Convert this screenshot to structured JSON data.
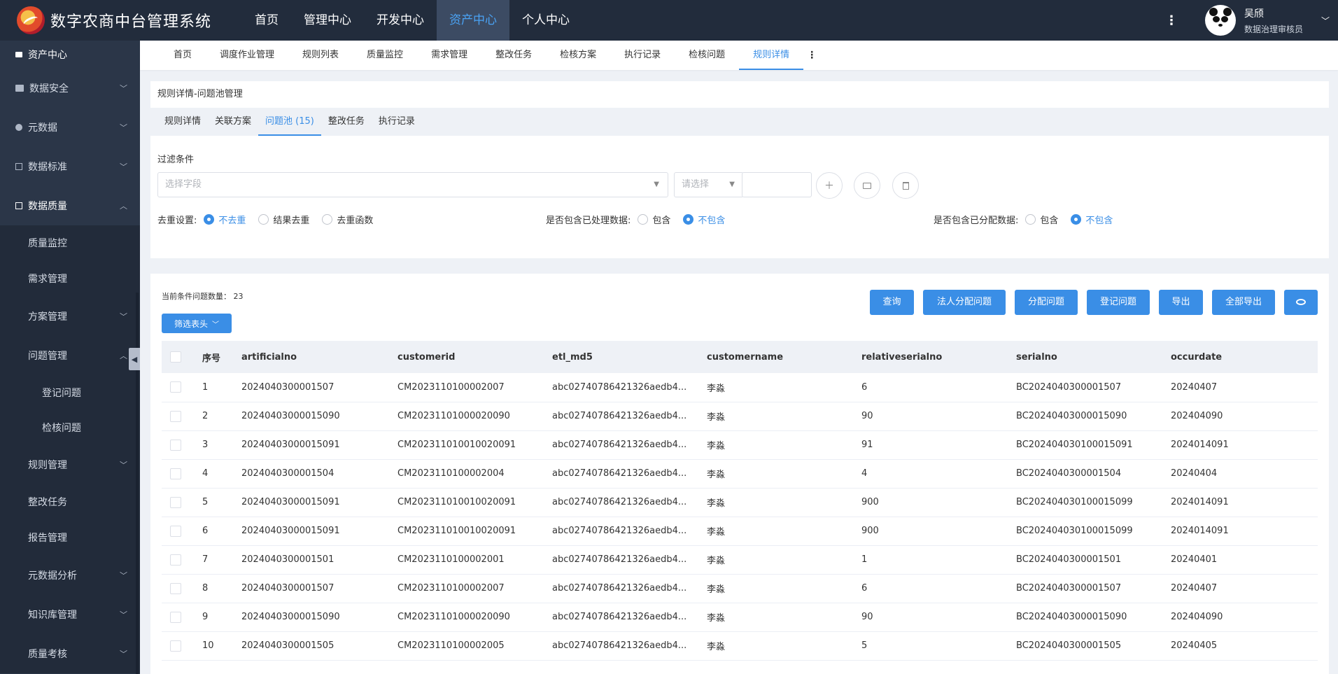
{
  "app": {
    "title": "数字农商中台管理系统"
  },
  "topnav": [
    "首页",
    "管理中心",
    "开发中心",
    "资产中心",
    "个人中心"
  ],
  "topnav_active": 3,
  "user": {
    "name": "吴颀",
    "role": "数据治理审核员"
  },
  "sidebar": {
    "head": "资产中心",
    "items": [
      {
        "label": "数据安全",
        "icon": "folder-icon"
      },
      {
        "label": "元数据",
        "icon": "pie-icon"
      },
      {
        "label": "数据标准",
        "icon": "edit-icon"
      },
      {
        "label": "数据质量",
        "icon": "calendar-icon"
      }
    ],
    "quality_children": [
      {
        "label": "质量监控"
      },
      {
        "label": "需求管理"
      },
      {
        "label": "方案管理"
      },
      {
        "label": "问题管理"
      },
      {
        "label": "登记问题"
      },
      {
        "label": "检核问题"
      },
      {
        "label": "规则管理"
      },
      {
        "label": "整改任务"
      },
      {
        "label": "报告管理"
      },
      {
        "label": "元数据分析"
      },
      {
        "label": "知识库管理"
      },
      {
        "label": "质量考核"
      }
    ]
  },
  "tabs": [
    "首页",
    "调度作业管理",
    "规则列表",
    "质量监控",
    "需求管理",
    "整改任务",
    "检核方案",
    "执行记录",
    "检核问题",
    "规则详情"
  ],
  "tabs_active": 9,
  "panel": {
    "title": "规则详情-问题池管理",
    "subtabs": [
      "规则详情",
      "关联方案",
      "问题池 (15)",
      "整改任务",
      "执行记录"
    ],
    "subtabs_active": 2,
    "filter_label": "过滤条件",
    "field_placeholder": "选择字段",
    "op_placeholder": "请选择",
    "dedup_label": "去重设置:",
    "dedup_options": [
      "不去重",
      "结果去重",
      "去重函数"
    ],
    "processed_label": "是否包含已处理数据:",
    "processed_options": [
      "包含",
      "不包含"
    ],
    "assigned_label": "是否包含已分配数据:",
    "assigned_options": [
      "包含",
      "不包含"
    ]
  },
  "results": {
    "count_text": "当前条件问题数量： 23",
    "filter_head_button": "筛选表头",
    "buttons": [
      "查询",
      "法人分配问题",
      "分配问题",
      "登记问题",
      "导出",
      "全部导出"
    ],
    "columns": [
      "序号",
      "artificialno",
      "customerid",
      "etl_md5",
      "customername",
      "relativeserialno",
      "serialno",
      "occurdate"
    ],
    "rows": [
      [
        "1",
        "2024040300001507",
        "CM2023110100002007",
        "abc02740786421326aedb4...",
        "李淼",
        "6",
        "BC2024040300001507",
        "20240407"
      ],
      [
        "2",
        "20240403000015090",
        "CM20231101000020090",
        "abc02740786421326aedb4...",
        "李淼",
        "90",
        "BC20240403000015090",
        "202404090"
      ],
      [
        "3",
        "20240403000015091",
        "CM202311010010020091",
        "abc02740786421326aedb4...",
        "李淼",
        "91",
        "BC202404030100015091",
        "2024014091"
      ],
      [
        "4",
        "2024040300001504",
        "CM2023110100002004",
        "abc02740786421326aedb4...",
        "李淼",
        "4",
        "BC2024040300001504",
        "20240404"
      ],
      [
        "5",
        "20240403000015091",
        "CM202311010010020091",
        "abc02740786421326aedb4...",
        "李淼",
        "900",
        "BC202404030100015099",
        "2024014091"
      ],
      [
        "6",
        "20240403000015091",
        "CM202311010010020091",
        "abc02740786421326aedb4...",
        "李淼",
        "900",
        "BC202404030100015099",
        "2024014091"
      ],
      [
        "7",
        "2024040300001501",
        "CM2023110100002001",
        "abc02740786421326aedb4...",
        "李淼",
        "1",
        "BC2024040300001501",
        "20240401"
      ],
      [
        "8",
        "2024040300001507",
        "CM2023110100002007",
        "abc02740786421326aedb4...",
        "李淼",
        "6",
        "BC2024040300001507",
        "20240407"
      ],
      [
        "9",
        "20240403000015090",
        "CM20231101000020090",
        "abc02740786421326aedb4...",
        "李淼",
        "90",
        "BC20240403000015090",
        "202404090"
      ],
      [
        "10",
        "2024040300001505",
        "CM2023110100002005",
        "abc02740786421326aedb4...",
        "李淼",
        "5",
        "BC2024040300001505",
        "20240405"
      ]
    ]
  },
  "colors": {
    "accent": "#3a8ee6",
    "topbar": "#222c3c",
    "sidebar": "#2b3648"
  }
}
